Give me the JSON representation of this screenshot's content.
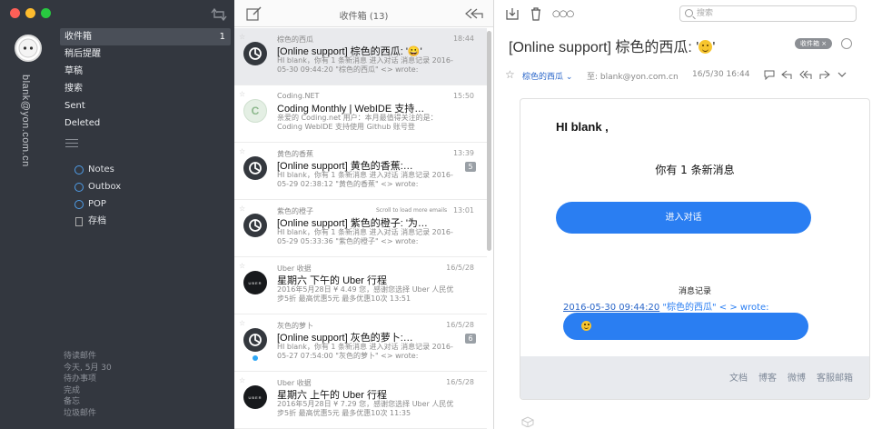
{
  "sidebar": {
    "account_email": "blank@yon.com.cn",
    "folders": [
      {
        "label": "收件箱",
        "count": "1"
      },
      {
        "label": "稍后提醒"
      },
      {
        "label": "草稿"
      },
      {
        "label": "搜索"
      },
      {
        "label": "Sent"
      },
      {
        "label": "Deleted"
      }
    ],
    "subfolders": [
      {
        "label": "Notes",
        "icon": "ring-icon"
      },
      {
        "label": "Outbox",
        "icon": "ring-icon"
      },
      {
        "label": "POP",
        "icon": "ring-icon"
      },
      {
        "label": "存档",
        "icon": "doc-icon"
      }
    ],
    "bottom_items": [
      "待读邮件",
      "今天, 5月 30",
      "待办事项",
      "完成",
      "备忘",
      "垃圾邮件"
    ]
  },
  "list": {
    "title": "收件箱 (13)",
    "tooltip": "Scroll to load more emails",
    "messages": [
      {
        "sender": "棕色的西瓜",
        "date": "18:44",
        "subject": "[Online support] 棕色的西瓜: '😀'",
        "preview": "HI blank，你有 1 条新消息 进入对话 消息记录 2016-05-30 09:44:20 \"棕色的西瓜\" <> wrote:",
        "avatar": "dark",
        "selected": true
      },
      {
        "sender": "Coding.NET",
        "date": "15:50",
        "subject": "Coding Monthly | WebIDE 支持…",
        "preview": "亲爱的 Coding.net 用户：本月最值得关注的是：Coding WebIDE 支持使用 Github 账号登",
        "avatar": "green",
        "avatar_text": "C"
      },
      {
        "sender": "黄色的香蕉",
        "date": "13:39",
        "subject": "[Online support] 黄色的香蕉:…",
        "preview": "HI blank，你有 1 条新消息 进入对话 消息记录 2016-05-29 02:38:12 \"黄色的香蕉\" <> wrote:",
        "avatar": "dark",
        "badge": "5"
      },
      {
        "sender": "紫色的橙子",
        "date": "13:01",
        "subject": "[Online support] 紫色的橙子: '为…",
        "preview": "HI blank，你有 1 条新消息 进入对话 消息记录 2016-05-29 05:33:36 \"紫色的橙子\" <> wrote:",
        "avatar": "dark"
      },
      {
        "sender": "Uber 收据",
        "date": "16/5/28",
        "subject": "星期六 下午的 Uber 行程",
        "preview": "2016年5月28日 ¥ 4.49 您，感谢您选择 Uber 人民优步5折 最高优惠5元 最多优惠10次 13:51",
        "avatar": "uber",
        "avatar_text": "UBER"
      },
      {
        "sender": "灰色的萝卜",
        "date": "16/5/28",
        "subject": "[Online support] 灰色的萝卜:…",
        "preview": "HI blank，你有 1 条新消息 进入对话 消息记录 2016-05-27 07:54:00 \"灰色的萝卜\" <> wrote:",
        "avatar": "dark",
        "badge": "6",
        "unread": true
      },
      {
        "sender": "Uber 收据",
        "date": "16/5/28",
        "subject": "星期六 上午的 Uber 行程",
        "preview": "2016年5月28日 ¥ 7.29 您，感谢您选择 Uber 人民优步5折 最高优惠5元 最多优惠10次 11:35",
        "avatar": "uber",
        "avatar_text": "UBER"
      }
    ]
  },
  "reader": {
    "search_placeholder": "搜索",
    "subject": "[Online support] 棕色的西瓜: '",
    "subject_tail": "'",
    "tag_label": "收件箱 ×",
    "from": "棕色的西瓜 ⌄",
    "to": "至: blank@yon.com.cn",
    "time": "16/5/30 16:44",
    "card": {
      "greeting": "HI blank ,",
      "count_text": "你有 1 条新消息",
      "button_label": "进入对话",
      "history_title": "消息记录",
      "history_link": "2016-05-30 09:44:20",
      "history_quote": " \"棕色的西瓜\"",
      "history_tail": " < > wrote:",
      "footer_links": [
        "文档",
        "博客",
        "微博",
        "客服邮箱"
      ]
    }
  },
  "colors": {
    "sidebar_bg": "#33373f",
    "accent_blue": "#2a7ef2",
    "link_blue": "#2a66c9",
    "unread_dot": "#2ea7f5"
  }
}
